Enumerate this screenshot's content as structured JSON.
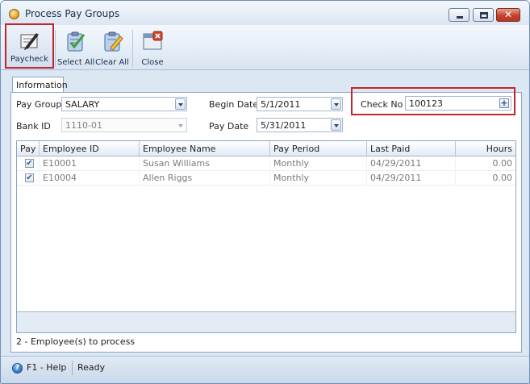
{
  "window": {
    "title": "Process Pay Groups"
  },
  "toolbar": {
    "paycheck_label": "Paycheck",
    "select_all_label": "Select All",
    "clear_all_label": "Clear All",
    "close_label": "Close"
  },
  "tabs": [
    {
      "label": "Information"
    }
  ],
  "form": {
    "pay_group_label": "Pay Group",
    "pay_group_value": "SALARY",
    "bank_id_label": "Bank ID",
    "bank_id_value": "1110-01",
    "begin_date_label": "Begin Date",
    "begin_date_value": "5/1/2011",
    "pay_date_label": "Pay Date",
    "pay_date_value": "5/31/2011",
    "check_no_label": "Check No",
    "check_no_value": "100123"
  },
  "grid": {
    "columns": [
      "Pay",
      "Employee ID",
      "Employee Name",
      "Pay Period",
      "Last Paid",
      "Hours"
    ],
    "rows": [
      {
        "pay": true,
        "employee_id": "E10001",
        "employee_name": "Susan Williams",
        "pay_period": "Monthly",
        "last_paid": "04/29/2011",
        "hours": "0.00"
      },
      {
        "pay": true,
        "employee_id": "E10004",
        "employee_name": "Allen Riggs",
        "pay_period": "Monthly",
        "last_paid": "04/29/2011",
        "hours": "0.00"
      }
    ]
  },
  "employees_to_process": "2 - Employee(s) to process",
  "status": {
    "help": "F1 - Help",
    "state": "Ready"
  },
  "colors": {
    "highlight_border": "#c0262c",
    "accent": "#2c6fc0"
  }
}
